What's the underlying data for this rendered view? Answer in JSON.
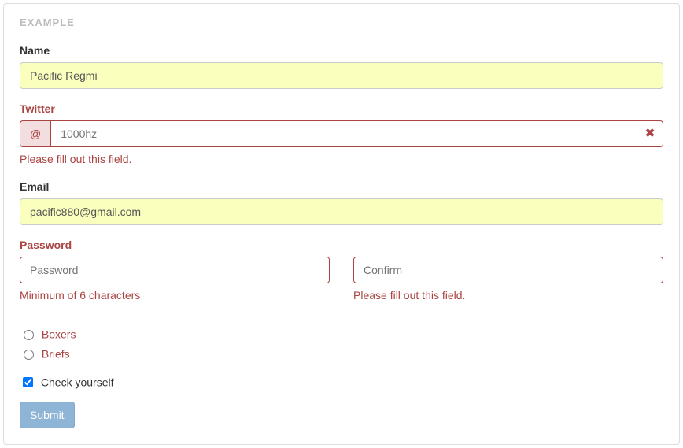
{
  "panel_title": "EXAMPLE",
  "name": {
    "label": "Name",
    "value": "Pacific Regmi"
  },
  "twitter": {
    "label": "Twitter",
    "addon": "@",
    "placeholder": "1000hz",
    "value": "",
    "error": "Please fill out this field."
  },
  "email": {
    "label": "Email",
    "value": "pacific880@gmail.com"
  },
  "password": {
    "label": "Password",
    "placeholder": "Password",
    "value": "",
    "error": "Minimum of 6 characters"
  },
  "confirm": {
    "placeholder": "Confirm",
    "value": "",
    "error": "Please fill out this field."
  },
  "underwear": {
    "option1": "Boxers",
    "option2": "Briefs"
  },
  "check": {
    "label": "Check yourself"
  },
  "submit_label": "Submit"
}
